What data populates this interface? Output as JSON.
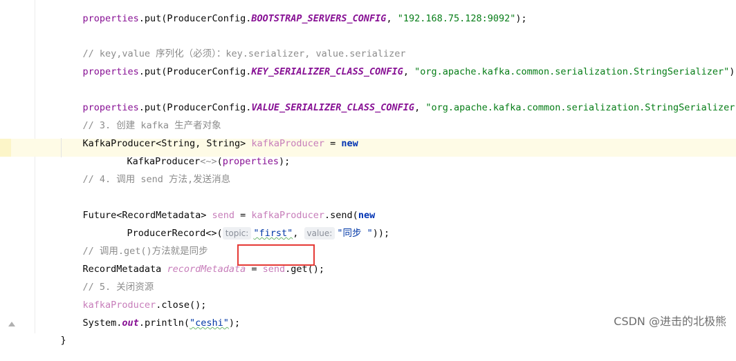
{
  "code": {
    "line1": {
      "t1": "properties",
      "t2": ".put(ProducerConfig.",
      "t3": "BOOTSTRAP_SERVERS_CONFIG",
      "t4": ", ",
      "t5": "\"192.168.75.128:9092\"",
      "t6": ");"
    },
    "line2": {
      "t1": "// key,value 序列化（必须）：key.serializer, value.serializer"
    },
    "line3": {
      "t1": "properties",
      "t2": ".put(ProducerConfig.",
      "t3": "KEY_SERIALIZER_CLASS_CONFIG",
      "t4": ", ",
      "t5": "\"org.apache.kafka.common.serialization.StringSerializer\"",
      "t6": ");"
    },
    "line4": {
      "t1": "properties",
      "t2": ".put(ProducerConfig.",
      "t3": "VALUE_SERIALIZER_CLASS_CONFIG",
      "t4": ", ",
      "t5": "\"org.apache.kafka.common.serialization.StringSerializer\"",
      "t6": ");"
    },
    "line5": {
      "t1": "// 3. 创建 kafka 生产者对象"
    },
    "line6": {
      "t1": "KafkaProducer<String, String> ",
      "t2": "kafkaProducer",
      "t3": " = ",
      "t4": "new"
    },
    "line7": {
      "t1": "KafkaProducer",
      "t2": "<~>",
      "t3": "(",
      "t4": "properties",
      "t5": ");"
    },
    "line8": {
      "t1": "// 4. 调用 send 方法,发送消息"
    },
    "line9": {
      "t1": "Future<RecordMetadata> ",
      "t2": "send",
      "t3": " = ",
      "t4": "kafkaProducer",
      "t5": ".send(",
      "t6": "new"
    },
    "line10": {
      "t1": "ProducerRecord<>(",
      "hint_topic": "topic:",
      "t2": "\"first\"",
      "t3": ", ",
      "hint_value": "value:",
      "t4": "\"同步 \"",
      "t5": "));"
    },
    "line11": {
      "t1": "// 调用.get()方法就是同步"
    },
    "line12": {
      "t1": "RecordMetadata ",
      "t2": "recordMetadata",
      "t3": " = ",
      "t4": "send",
      "t5": ".get();"
    },
    "line13": {
      "t1": "// 5. 关闭资源"
    },
    "line14": {
      "t1": "kafkaProducer",
      "t2": ".close();"
    },
    "line15": {
      "t1": "System.",
      "t2": "out",
      "t3": ".println(",
      "t4": "\"ceshi\"",
      "t5": ");"
    },
    "line16": {
      "t1": "}"
    }
  },
  "watermark": "CSDN @进击的北极熊"
}
